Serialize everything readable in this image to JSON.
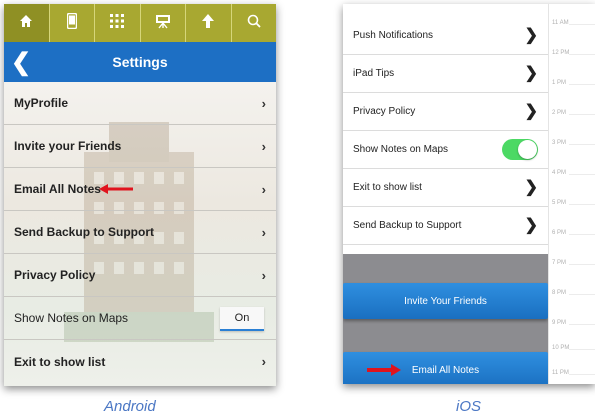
{
  "android": {
    "tab_icons": [
      "home-icon",
      "phone-icon",
      "grid-icon",
      "presentation-icon",
      "map-pin-icon",
      "search-icon"
    ],
    "header": {
      "back_glyph": "❮",
      "title": "Settings"
    },
    "rows": [
      {
        "label": "MyProfile",
        "control": "chevron"
      },
      {
        "label": "Invite your Friends",
        "control": "chevron"
      },
      {
        "label": "Email All Notes",
        "control": "chevron",
        "highlighted": true
      },
      {
        "label": "Send Backup to Support",
        "control": "chevron"
      },
      {
        "label": "Privacy Policy",
        "control": "chevron"
      },
      {
        "label": "Show Notes on Maps",
        "control": "toggle",
        "toggle_value": "On"
      },
      {
        "label": "Exit to show list",
        "control": "chevron"
      }
    ],
    "caption": "Android"
  },
  "ios": {
    "rows": [
      {
        "label": "Push Notifications",
        "control": "chevron"
      },
      {
        "label": "iPad Tips",
        "control": "chevron"
      },
      {
        "label": "Privacy Policy",
        "control": "chevron"
      },
      {
        "label": "Show Notes on Maps",
        "control": "switch",
        "switch_on": true
      },
      {
        "label": "Exit to show list",
        "control": "chevron"
      },
      {
        "label": "Send Backup to Support",
        "control": "chevron"
      }
    ],
    "buttons": {
      "invite": "Invite Your Friends",
      "email": "Email All Notes"
    },
    "calendar_hours": [
      "11 AM",
      "12 PM",
      "1 PM",
      "2 PM",
      "3 PM",
      "4 PM",
      "5 PM",
      "6 PM",
      "7 PM",
      "8 PM",
      "9 PM",
      "10 PM",
      "11 PM"
    ],
    "caption": "iOS"
  },
  "colors": {
    "android_tab_bar": "#a8a831",
    "android_header": "#1d6fc4",
    "ios_button": "#1a6fc0",
    "ios_switch": "#4cd964",
    "annotation_arrow": "#e0141e",
    "caption": "#4b77c4"
  },
  "chevron_glyph": "›",
  "ios_chevron_glyph": "❯"
}
